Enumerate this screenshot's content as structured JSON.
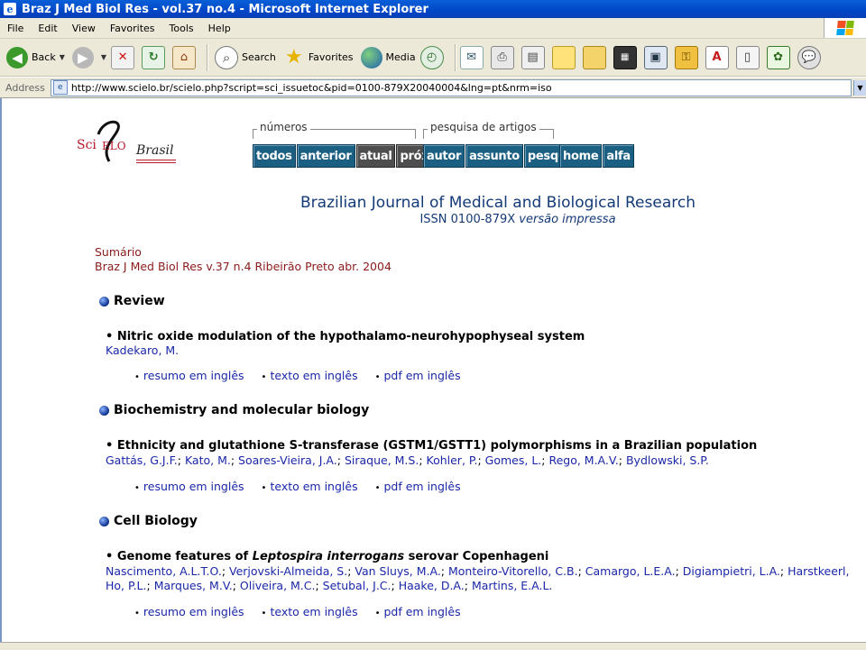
{
  "window": {
    "title": "Braz J Med Biol Res - vol.37 no.4 - Microsoft Internet Explorer",
    "icon_glyph": "e"
  },
  "menu": [
    "File",
    "Edit",
    "View",
    "Favorites",
    "Tools",
    "Help"
  ],
  "toolbar": {
    "back_label": "Back",
    "search_label": "Search",
    "favorites_label": "Favorites",
    "media_label": "Media"
  },
  "address": {
    "label": "Address",
    "url": "http://www.scielo.br/scielo.php?script=sci_issuetoc&pid=0100-879X20040004&lng=pt&nrm=iso"
  },
  "logo": {
    "sci": "Sci",
    "elo": "ELO",
    "brasil": "Brasil"
  },
  "nav": {
    "numeros_legend": "números",
    "numeros": [
      "todos",
      "anterior",
      "atual",
      "próximo"
    ],
    "pesquisa_legend": "pesquisa de artigos",
    "pesquisa": [
      "autor",
      "assunto",
      "pesquisa"
    ],
    "other": [
      "home",
      "alfa"
    ]
  },
  "journal": {
    "title": "Brazilian Journal of Medical and Biological Research",
    "issn": "ISSN 0100-879X",
    "issn_suffix": "versão impressa"
  },
  "summary": {
    "label": "Sumário",
    "issue": "Braz J Med Biol Res v.37 n.4 Ribeirão Preto abr. 2004"
  },
  "link_labels": [
    "resumo em inglês",
    "texto em inglês",
    "pdf em inglês"
  ],
  "sections": [
    {
      "name": "Review",
      "article": {
        "title": "Nitric oxide modulation of the hypothalamo-neurohypophyseal system",
        "authors": [
          "Kadekaro, M."
        ]
      }
    },
    {
      "name": "Biochemistry and molecular biology",
      "article": {
        "title": "Ethnicity and glutathione S-transferase (GSTM1/GSTT1) polymorphisms in a Brazilian population",
        "authors": [
          "Gattás, G.J.F.",
          "Kato, M.",
          "Soares-Vieira, J.A.",
          "Siraque, M.S.",
          "Kohler, P.",
          "Gomes, L.",
          "Rego, M.A.V.",
          "Bydlowski, S.P."
        ]
      }
    },
    {
      "name": "Cell Biology",
      "article": {
        "title_prefix": "Genome features of",
        "title_italic": "Leptospira interrogans",
        "title_suffix": "serovar Copenhageni",
        "authors_line1": [
          "Nascimento, A.L.T.O.",
          "Verjovski-Almeida, S.",
          "Van Sluys, M.A.",
          "Monteiro-Vitorello, C.B.",
          "Camargo, L.E.A.",
          "Digiampietri, L.A.",
          "Harstkeerl,"
        ],
        "authors_line2": [
          "Ho, P.L.",
          "Marques, M.V.",
          "Oliveira, M.C.",
          "Setubal, J.C.",
          "Haake, D.A.",
          "Martins, E.A.L."
        ]
      }
    }
  ]
}
